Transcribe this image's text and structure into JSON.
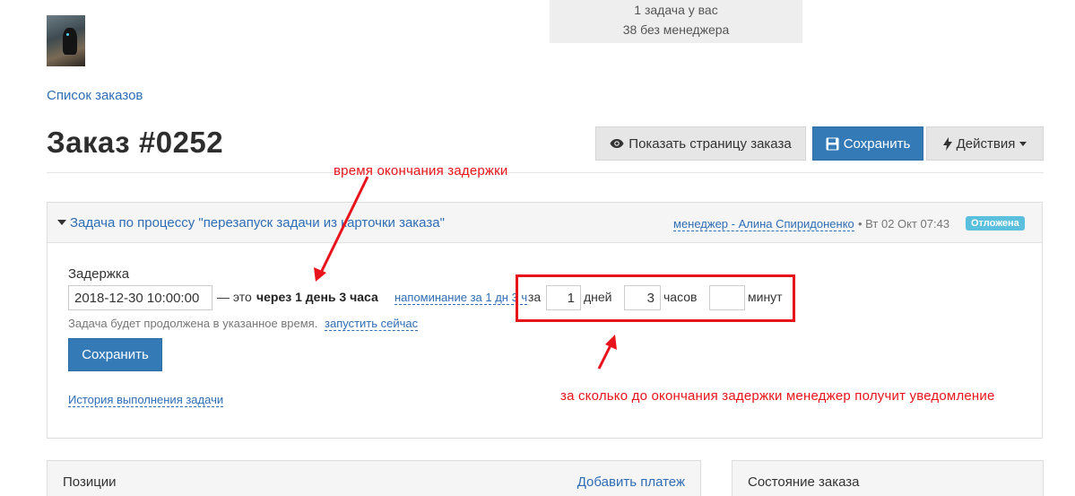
{
  "notification": {
    "line1": "1 задача у вас",
    "line2": "38 без менеджера"
  },
  "breadcrumb": "Список заказов",
  "page_title": "Заказ #0252",
  "toolbar": {
    "show_page_label": "Показать страницу заказа",
    "save_label": "Сохранить",
    "actions_label": "Действия",
    "show_page_icon": "eye-icon",
    "save_icon": "floppy-disk-icon",
    "actions_icon": "lightning-bolt-icon"
  },
  "task": {
    "title": "Задача по процессу \"перезапуск задачи из карточки заказа\"",
    "manager": "менеджер - Алина Спиридоненко",
    "date": "• Вт 02 Окт 07:43",
    "status": "Отложена",
    "delay_label": "Задержка",
    "delay_value": "2018-12-30 10:00:00",
    "this_text": "— это",
    "through_text": "через 1 день 3 часа",
    "reminder_link": "напоминание за 1 дн 3 ч",
    "za_text": "за",
    "days_value": "1",
    "days_label": "дней",
    "hours_value": "3",
    "hours_label": "часов",
    "minutes_value": "",
    "minutes_label": "минут",
    "hint": "Задача будет продолжена в указанное время.",
    "run_now_link": "запустить сейчас",
    "save_button": "Сохранить",
    "history_link": "История выполнения задачи"
  },
  "annotations": {
    "top": "время окончания задержки",
    "bottom": "за сколько до окончания задержки менеджер получит уведомление",
    "color": "#e8141b"
  },
  "positions": {
    "title": "Позиции",
    "add_payment": "Добавить платеж"
  },
  "order_state": {
    "title": "Состояние заказа"
  },
  "colors": {
    "primary": "#337ab7",
    "link": "#2f6db4",
    "badge": "#5bc0de"
  }
}
